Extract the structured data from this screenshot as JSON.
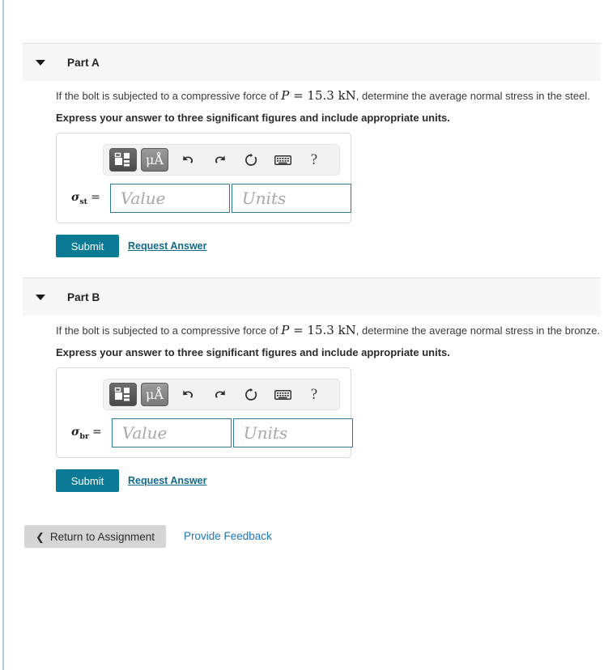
{
  "theme": {
    "accent_teal": "#0b7b95",
    "link_blue": "#106a8c",
    "feedback_blue": "#2077b8",
    "header_bg": "#f7f7f7",
    "rail_blue": "#b4c9d9",
    "field_border": "#2b7a99",
    "button_grey": "#d5d5d5"
  },
  "parts": [
    {
      "id": "part-a",
      "title": "Part A",
      "caret": "caret-down-icon",
      "question_pre": "If the bolt is subjected to a compressive force of ",
      "question_math_var": "P",
      "question_math_eq": " = ",
      "question_math_val": "15.3 kN",
      "question_post": ", determine the average normal stress in the steel.",
      "instruction": "Express your answer to three significant figures and include appropriate units.",
      "symbol_base": "σ",
      "symbol_sub": "st",
      "symbol_eq": "=",
      "value_placeholder": "Value",
      "units_placeholder": "Units",
      "value_text": "",
      "units_text": "",
      "submit_label": "Submit",
      "request_answer_label": "Request Answer"
    },
    {
      "id": "part-b",
      "title": "Part B",
      "caret": "caret-down-icon",
      "question_pre": "If the bolt is subjected to a compressive force of ",
      "question_math_var": "P",
      "question_math_eq": " = ",
      "question_math_val": "15.3 kN",
      "question_post": ", determine the average normal stress in the bronze.",
      "instruction": "Express your answer to three significant figures and include appropriate units.",
      "symbol_base": "σ",
      "symbol_sub": "br",
      "symbol_eq": "=",
      "value_placeholder": "Value",
      "units_placeholder": "Units",
      "value_text": "",
      "units_text": "",
      "submit_label": "Submit",
      "request_answer_label": "Request Answer"
    }
  ],
  "toolbar": {
    "template_button": "math-template-icon",
    "units_button_label": "μÅ",
    "undo": "undo-icon",
    "redo": "redo-icon",
    "reset": "reset-icon",
    "keyboard": "keyboard-icon",
    "help": "?"
  },
  "footer": {
    "return_chevron": "❮",
    "return_label": "Return to Assignment",
    "feedback_label": "Provide Feedback"
  }
}
